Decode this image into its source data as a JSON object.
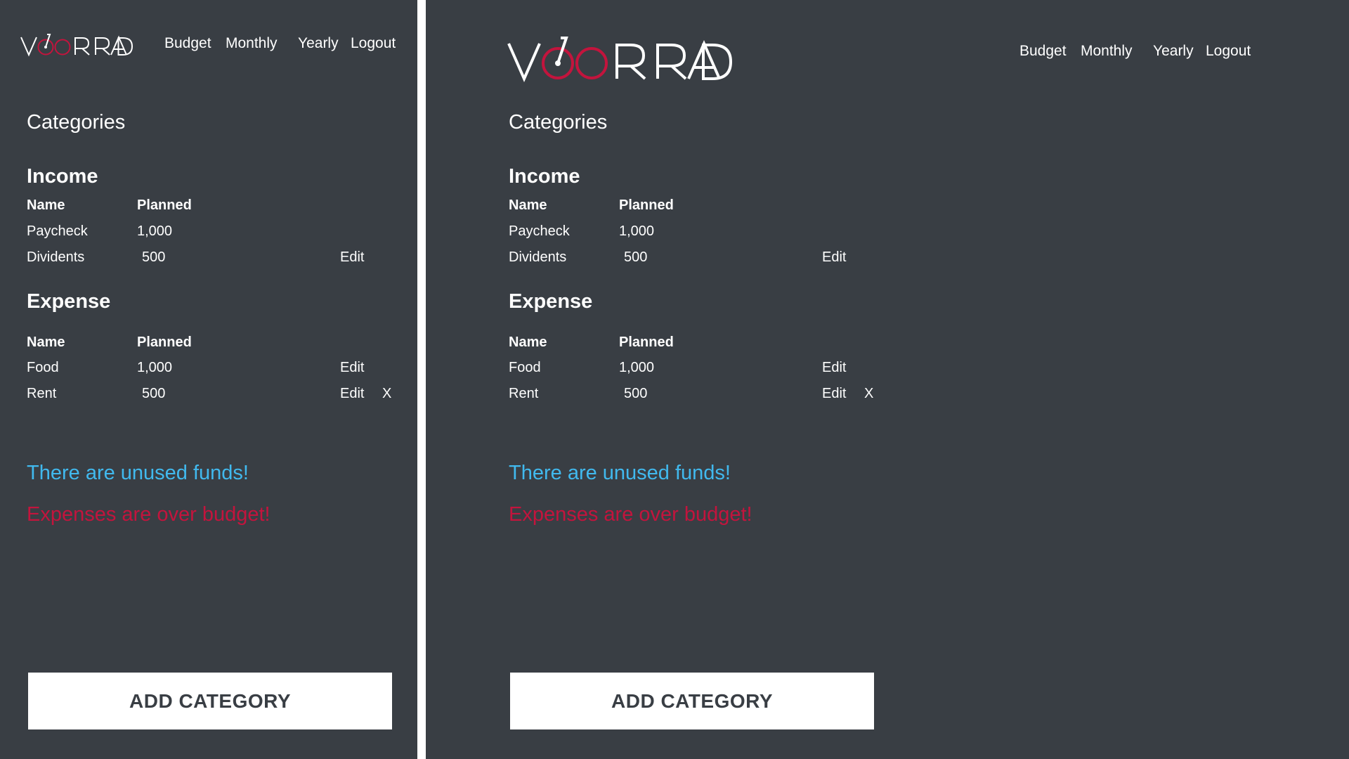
{
  "brand": {
    "logo_text": "VOORRAD",
    "colors": {
      "background": "#393e44",
      "text": "#ffffff",
      "accent": "#c3143d",
      "info": "#41b9ee"
    }
  },
  "nav": {
    "budget": "Budget",
    "monthly": "Monthly",
    "yearly": "Yearly",
    "logout": "Logout"
  },
  "page_title": "Categories",
  "income": {
    "heading": "Income",
    "col_name": "Name",
    "col_planned": "Planned",
    "rows": [
      {
        "name": "Paycheck",
        "planned": "1,000",
        "edit": "",
        "delete": ""
      },
      {
        "name": "Dividents",
        "planned": "500",
        "edit": "Edit",
        "delete": ""
      }
    ]
  },
  "expense": {
    "heading": "Expense",
    "col_name": "Name",
    "col_planned": "Planned",
    "rows": [
      {
        "name": "Food",
        "planned": "1,000",
        "edit": "Edit",
        "delete": ""
      },
      {
        "name": "Rent",
        "planned": "500",
        "edit": "Edit",
        "delete": "X"
      }
    ]
  },
  "messages": {
    "unused_funds": "There are unused funds!",
    "over_budget": "Expenses are over budget!"
  },
  "add_category_label": "ADD CATEGORY"
}
